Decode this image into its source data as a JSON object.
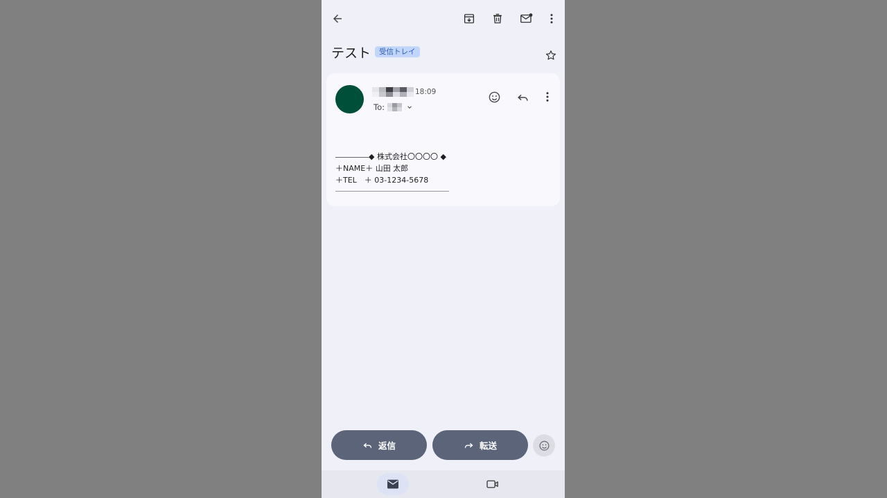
{
  "toolbar": {
    "back_icon": "arrow-back-icon",
    "archive_icon": "archive-icon",
    "delete_icon": "trash-icon",
    "mark_unread_icon": "mail-unread-icon",
    "more_icon": "more-vert-icon"
  },
  "subject": {
    "title": "テスト",
    "label": "受信トレイ",
    "star_icon": "star-outline-icon"
  },
  "message": {
    "avatar_color": "#004f38",
    "time": "18:09",
    "to_label": "To:",
    "body_lines": {
      "line1": "◆ 株式会社〇〇〇〇 ◆",
      "line2": "＋NAME＋ 山田 太郎",
      "line3": "＋TEL　＋ 03-1234-5678"
    }
  },
  "actions": {
    "reply_label": "返信",
    "forward_label": "転送"
  },
  "colors": {
    "background": "#808080",
    "screen": "#eff0f8",
    "card": "#f8f8fd",
    "pill": "#5b6478",
    "chip": "#c2d6fb"
  },
  "bottom_nav": {
    "mail_icon": "mail-icon",
    "meet_icon": "videocam-icon"
  }
}
